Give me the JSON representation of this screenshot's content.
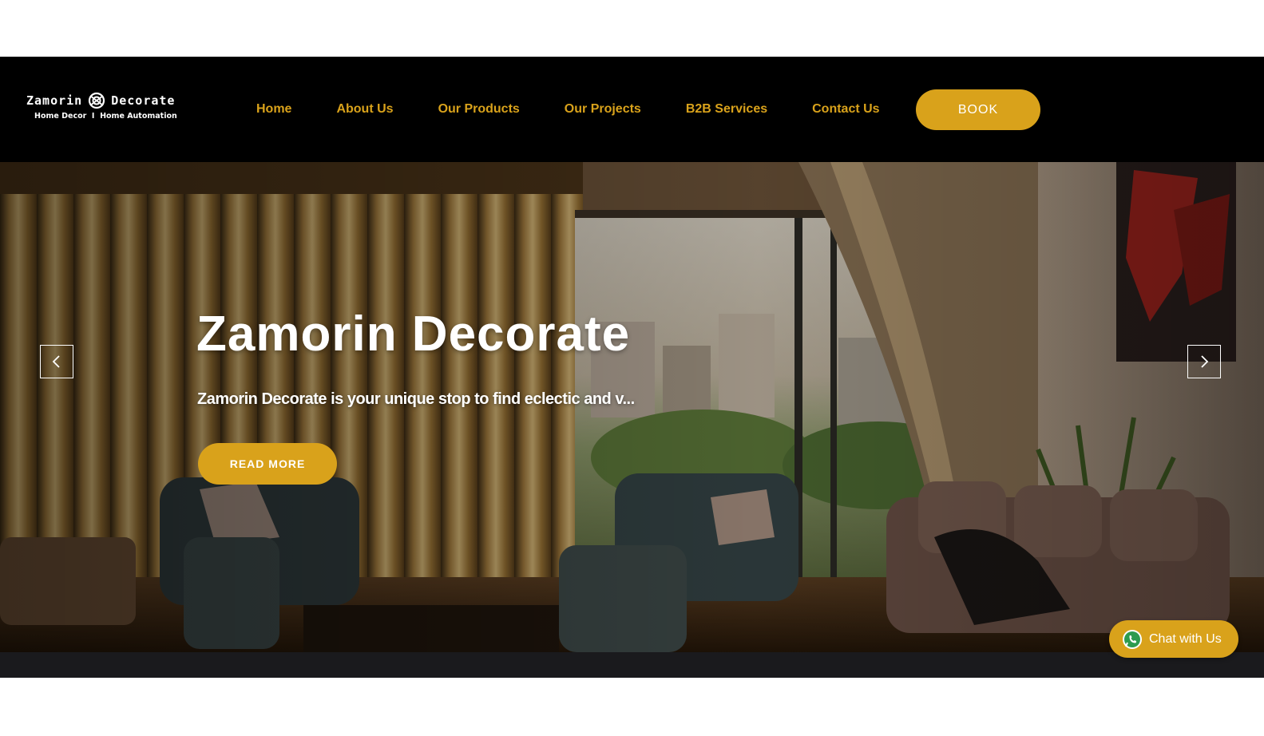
{
  "logo": {
    "name_left": "Zamorin",
    "name_right": "Decorate",
    "tagline": "Home Decor  I  Home Automation",
    "icon": "logo-knot-icon"
  },
  "nav": {
    "items": [
      {
        "label": "Home"
      },
      {
        "label": "About Us"
      },
      {
        "label": "Our Products"
      },
      {
        "label": "Our Projects"
      },
      {
        "label": "B2B Services"
      },
      {
        "label": "Contact Us"
      }
    ],
    "book_label": "BOOK"
  },
  "hero": {
    "title": "Zamorin Decorate",
    "subtitle": "Zamorin Decorate is your unique stop to find eclectic and v...",
    "cta_label": "READ MORE",
    "prev_icon": "chevron-left-icon",
    "next_icon": "chevron-right-icon"
  },
  "chat": {
    "label": "Chat with Us",
    "icon": "whatsapp-icon"
  },
  "colors": {
    "accent": "#d9a21b",
    "header_bg": "#000000",
    "page_bg": "#ffffff"
  }
}
